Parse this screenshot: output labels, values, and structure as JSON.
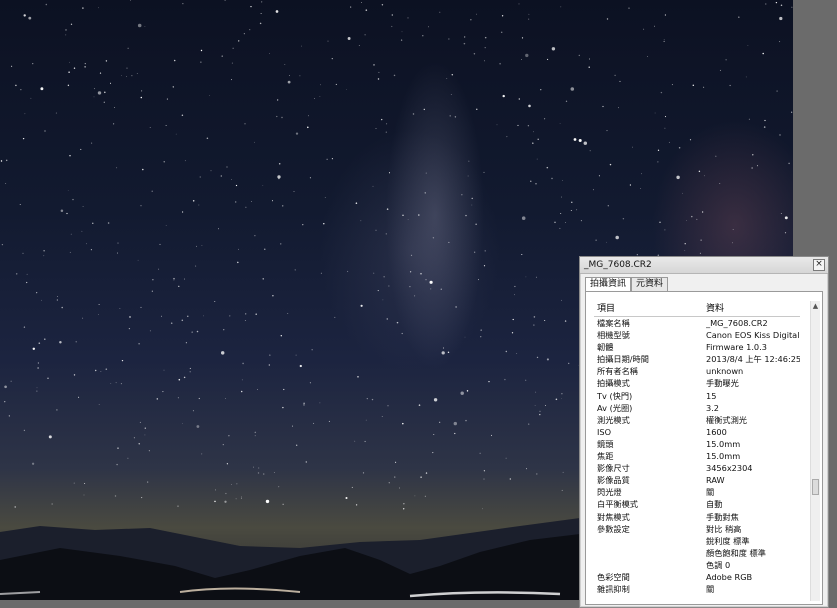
{
  "window": {
    "title": "_MG_7608.CR2",
    "close_label": "×"
  },
  "tabs": [
    {
      "label": "拍攝資訊",
      "active": true
    },
    {
      "label": "元資料",
      "active": false
    }
  ],
  "table": {
    "columns": {
      "item": "項目",
      "value": "資料"
    },
    "rows": [
      {
        "item": "檔案名稱",
        "value": "_MG_7608.CR2"
      },
      {
        "item": "相機型號",
        "value": "Canon EOS Kiss Digital N"
      },
      {
        "item": "韌體",
        "value": "Firmware 1.0.3"
      },
      {
        "item": "拍攝日期/時間",
        "value": "2013/8/4 上午 12:46:25"
      },
      {
        "item": "所有者名稱",
        "value": "unknown"
      },
      {
        "item": "拍攝模式",
        "value": "手動曝光"
      },
      {
        "item": "Tv (快門)",
        "value": "15"
      },
      {
        "item": "Av (光圈)",
        "value": "3.2"
      },
      {
        "item": "測光模式",
        "value": "權衡式測光"
      },
      {
        "item": "ISO",
        "value": "1600"
      },
      {
        "item": "鏡頭",
        "value": "15.0mm"
      },
      {
        "item": "焦距",
        "value": "15.0mm"
      },
      {
        "item": "影像尺寸",
        "value": "3456x2304"
      },
      {
        "item": "影像品質",
        "value": "RAW"
      },
      {
        "item": "閃光燈",
        "value": "關"
      },
      {
        "item": "白平衡模式",
        "value": "自動"
      },
      {
        "item": "對焦模式",
        "value": "手動對焦"
      },
      {
        "item": "參數設定",
        "value": "對比  稍高"
      },
      {
        "item": "",
        "value": "銳利度  標準"
      },
      {
        "item": "",
        "value": "顏色飽和度  標準"
      },
      {
        "item": "",
        "value": "色調      0"
      },
      {
        "item": "色彩空間",
        "value": "Adobe RGB"
      },
      {
        "item": "雜訊抑制",
        "value": "關"
      }
    ]
  },
  "scrollbar": {
    "up_arrow": "▲",
    "thumb_grip": "≡"
  }
}
